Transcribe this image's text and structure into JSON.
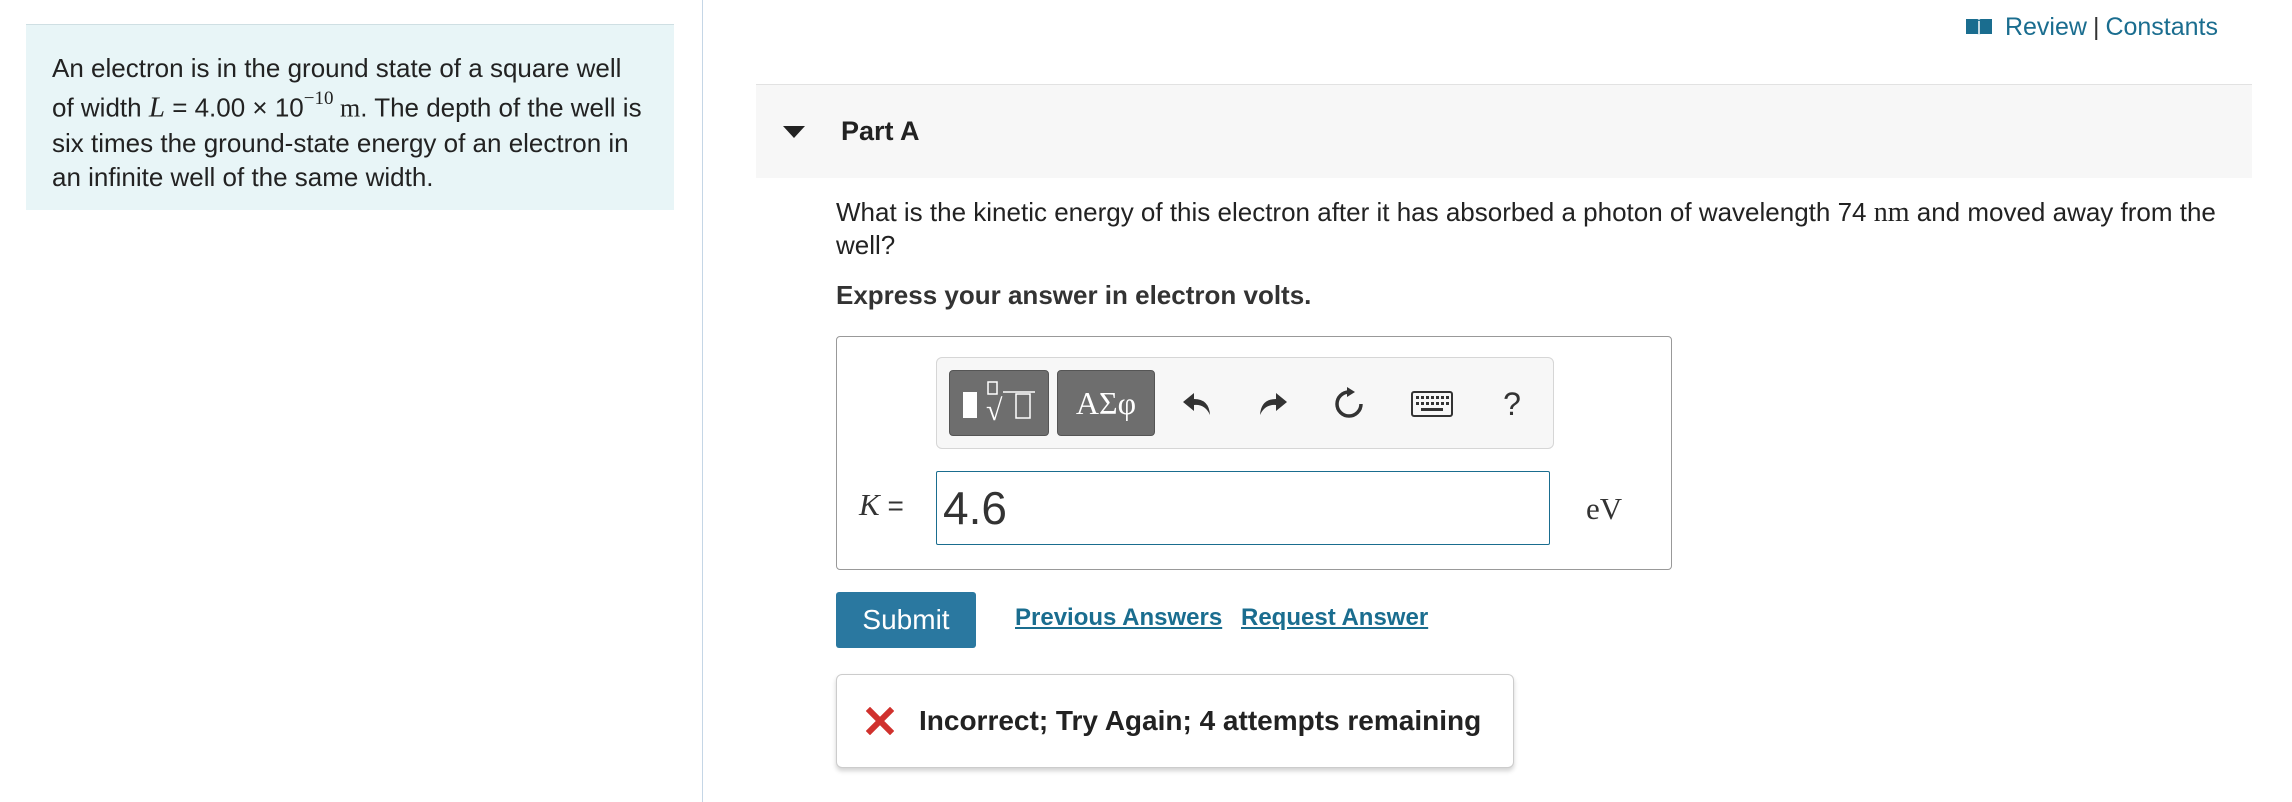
{
  "problem": {
    "text_1": "An electron is in the ground state of a square well of width ",
    "var_L": "L",
    "text_eq": " = 4.00 × 10",
    "exponent": "−10",
    "unit_m": " m",
    "text_2": ". The depth of the well is six times the ground-state energy of an electron in an infinite well of the same width."
  },
  "top_links": {
    "review": "Review",
    "separator": "|",
    "constants": "Constants"
  },
  "part": {
    "title": "Part A"
  },
  "question": {
    "text_1": "What is the kinetic energy of this electron after it has absorbed a photon of wavelength 74 ",
    "unit": "nm",
    "text_2": " and moved away from the well?"
  },
  "instruction": "Express your answer in electron volts.",
  "toolbar": {
    "symbols_label": "ΑΣφ",
    "help_label": "?"
  },
  "answer": {
    "variable": "K",
    "equals": " =",
    "value": "4.6",
    "unit": "eV"
  },
  "actions": {
    "submit_label": "Submit",
    "previous_answers": "Previous Answers",
    "request_answer": "Request Answer"
  },
  "feedback": {
    "message": "Incorrect; Try Again; 4 attempts remaining"
  },
  "colors": {
    "link": "#1a6d8f",
    "submit_bg": "#2a78a0",
    "panel_bg": "#e8f5f7",
    "error": "#d0312d"
  }
}
